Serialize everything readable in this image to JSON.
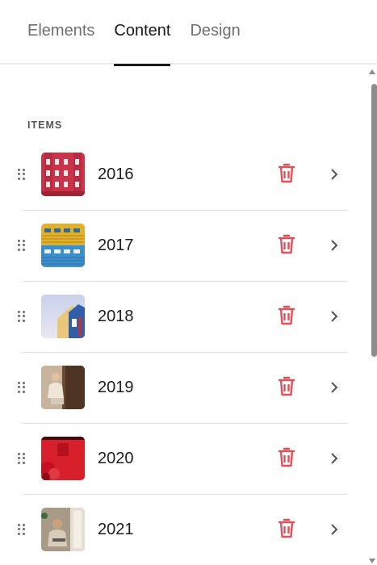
{
  "tabs": [
    {
      "label": "Elements",
      "active": false
    },
    {
      "label": "Content",
      "active": true
    },
    {
      "label": "Design",
      "active": false
    }
  ],
  "section": {
    "label": "ITEMS"
  },
  "items": [
    {
      "label": "2016",
      "thumb": "red-building"
    },
    {
      "label": "2017",
      "thumb": "yellow-blue-facade"
    },
    {
      "label": "2018",
      "thumb": "blue-house-sky"
    },
    {
      "label": "2019",
      "thumb": "woman-sitting-brown"
    },
    {
      "label": "2020",
      "thumb": "red-wall-flowers"
    },
    {
      "label": "2021",
      "thumb": "woman-laptop-window"
    }
  ],
  "colors": {
    "accent": "#1a1a1a",
    "delete": "#e0505a",
    "chevron": "#555555"
  }
}
